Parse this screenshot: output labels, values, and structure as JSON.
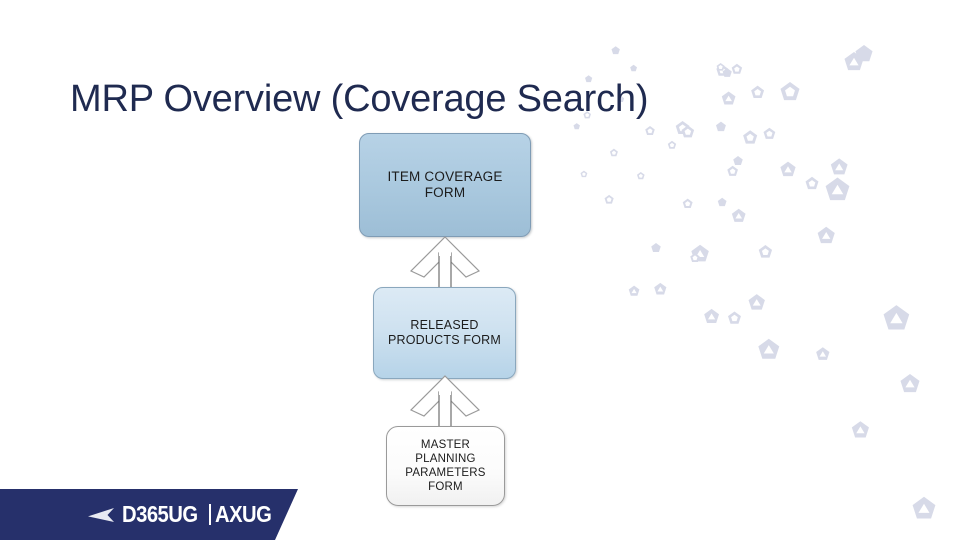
{
  "slide": {
    "title": "MRP Overview (Coverage Search)",
    "background_color": "#ffffff",
    "title_color": "#1f2a50"
  },
  "diagram": {
    "type": "flowchart",
    "direction": "bottom-to-top",
    "nodes": [
      {
        "id": "item-coverage-form",
        "label": "ITEM COVERAGE FORM",
        "line1": "ITEM COVERAGE",
        "line2": "FORM",
        "level": 3,
        "fill_color": "#a9c8de",
        "border_color": "#7f9cb5",
        "text_color": "#1c1c1c"
      },
      {
        "id": "released-products-form",
        "label": "RELEASED PRODUCTS FORM",
        "line1": "RELEASED",
        "line2": "PRODUCTS FORM",
        "level": 2,
        "fill_color": "#cfe2f0",
        "border_color": "#8aa7bd",
        "text_color": "#1c1c1c"
      },
      {
        "id": "master-planning-parameters-form",
        "label": "MASTER PLANNING PARAMETERS FORM",
        "line1": "MASTER",
        "line2": "PLANNING",
        "line3": "PARAMETERS",
        "line4": "FORM",
        "level": 1,
        "fill_color": "#ffffff",
        "border_color": "#9a9a9a",
        "text_color": "#1c1c1c"
      }
    ],
    "arrows": [
      {
        "id": "arrow-released-to-coverage",
        "from": "released-products-form",
        "to": "item-coverage-form",
        "style": "hollow-block-arrow",
        "direction": "up",
        "fill_color": "#ffffff",
        "stroke_color": "#9a9a9a"
      },
      {
        "id": "arrow-master-to-released",
        "from": "master-planning-parameters-form",
        "to": "released-products-form",
        "style": "hollow-block-arrow",
        "direction": "up",
        "fill_color": "#ffffff",
        "stroke_color": "#9a9a9a"
      }
    ]
  },
  "logo": {
    "wordmark_primary": "D365UG",
    "wordmark_secondary": "AXUG",
    "divider": "|",
    "banner_color": "#26306b",
    "text_color": "#ffffff",
    "swoosh_icon": "swoosh-icon"
  },
  "decor": {
    "pattern": "scattered-pentagons",
    "color": "#d7dae8"
  }
}
